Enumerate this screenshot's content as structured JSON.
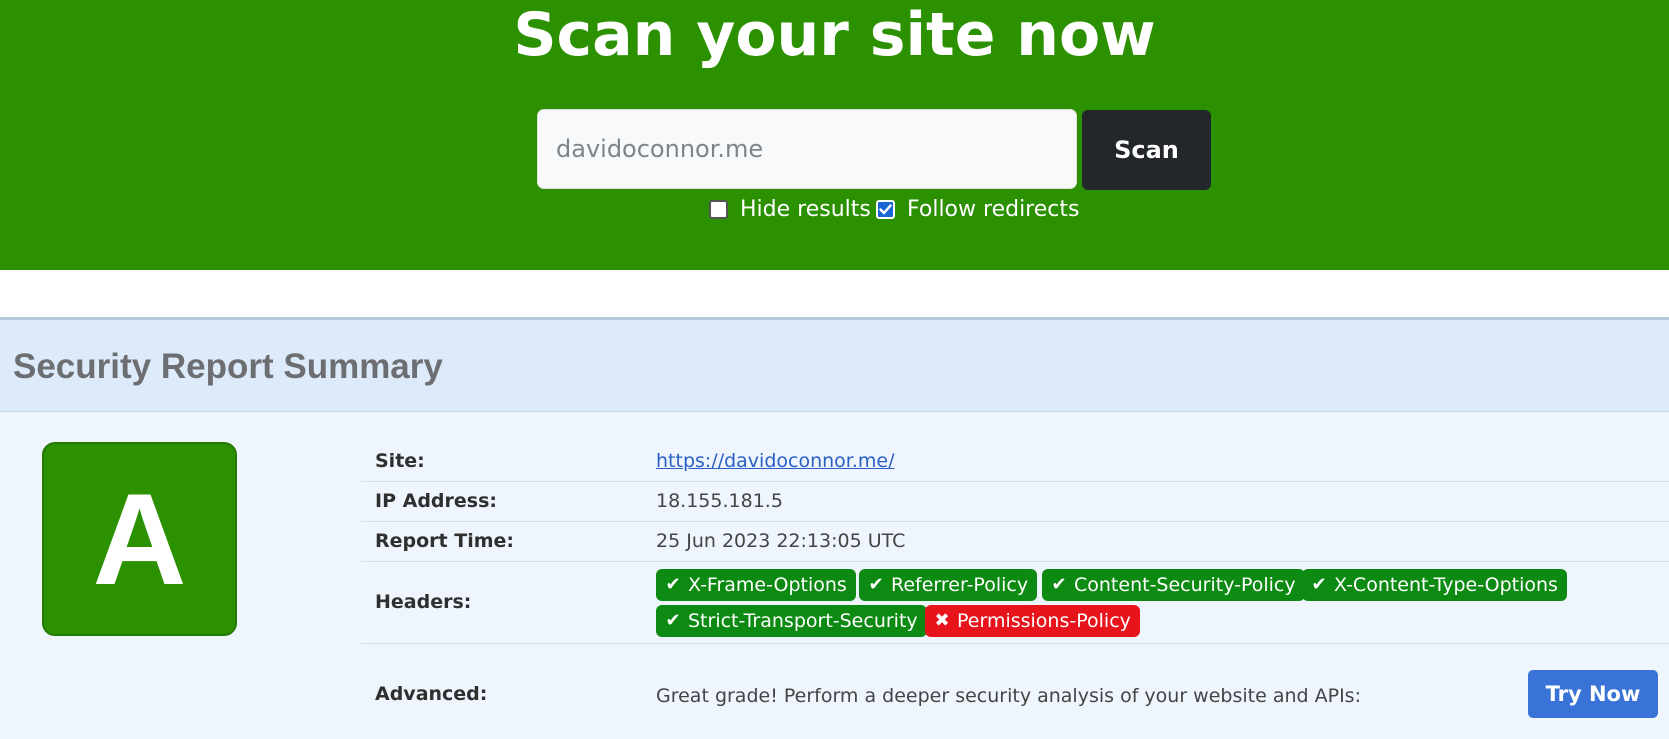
{
  "hero": {
    "title": "Scan your site now",
    "search": {
      "value": "",
      "placeholder": "davidoconnor.me"
    },
    "scan_button": "Scan",
    "options": [
      {
        "label": "Hide results",
        "checked": false
      },
      {
        "label": "Follow redirects",
        "checked": true
      }
    ]
  },
  "summary": {
    "title": "Security Report Summary",
    "grade": "A",
    "rows": {
      "site": {
        "label": "Site:",
        "value": "https://davidoconnor.me/"
      },
      "ip": {
        "label": "IP Address:",
        "value": "18.155.181.5"
      },
      "time": {
        "label": "Report Time:",
        "value": "25 Jun 2023 22:13:05 UTC"
      },
      "headers": {
        "label": "Headers:"
      },
      "advanced": {
        "label": "Advanced:",
        "value": "Great grade! Perform a deeper security analysis of your website and APIs:"
      }
    },
    "headers": [
      {
        "name": "X-Frame-Options",
        "status": "pass",
        "icon": "check-icon"
      },
      {
        "name": "Referrer-Policy",
        "status": "pass",
        "icon": "check-icon"
      },
      {
        "name": "Content-Security-Policy",
        "status": "pass",
        "icon": "check-icon"
      },
      {
        "name": "X-Content-Type-Options",
        "status": "pass",
        "icon": "check-icon"
      },
      {
        "name": "Strict-Transport-Security",
        "status": "pass",
        "icon": "check-icon"
      },
      {
        "name": "Permissions-Policy",
        "status": "fail",
        "icon": "cross-icon"
      }
    ],
    "try_button": "Try Now"
  },
  "colors": {
    "hero_bg": "#2b9100",
    "pass": "#0d8a12",
    "fail": "#e8141c",
    "accent": "#3a73d8"
  }
}
